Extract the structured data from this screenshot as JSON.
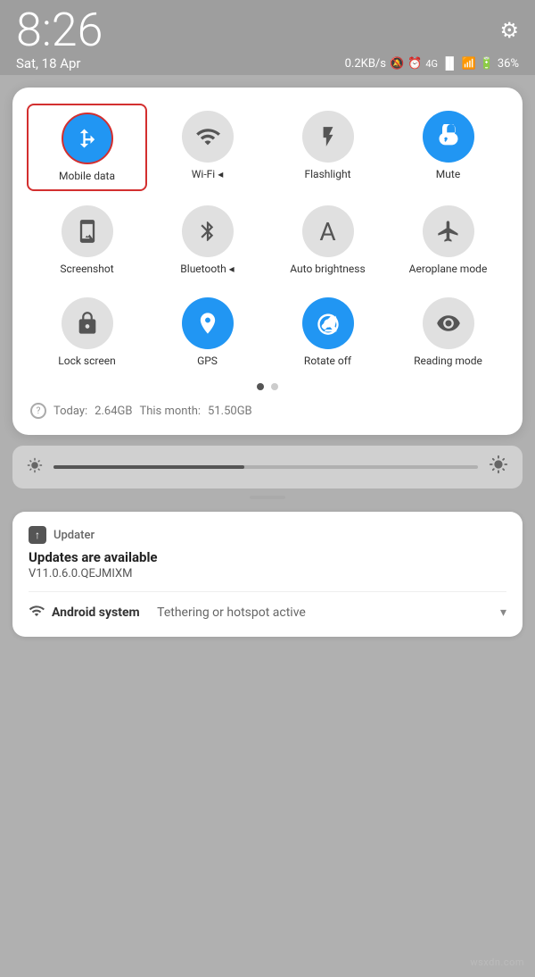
{
  "statusBar": {
    "time": "8:26",
    "date": "Sat, 18 Apr",
    "speed": "0.2KB/s",
    "battery": "36%"
  },
  "tiles": [
    {
      "id": "mobile-data",
      "label": "Mobile data",
      "state": "active",
      "selected": true
    },
    {
      "id": "wifi",
      "label": "Wi-Fi",
      "state": "inactive"
    },
    {
      "id": "flashlight",
      "label": "Flashlight",
      "state": "inactive"
    },
    {
      "id": "mute",
      "label": "Mute",
      "state": "active"
    },
    {
      "id": "screenshot",
      "label": "Screenshot",
      "state": "inactive"
    },
    {
      "id": "bluetooth",
      "label": "Bluetooth",
      "state": "inactive"
    },
    {
      "id": "auto-brightness",
      "label": "Auto brightness",
      "state": "inactive"
    },
    {
      "id": "aeroplane",
      "label": "Aeroplane mode",
      "state": "inactive"
    },
    {
      "id": "lock-screen",
      "label": "Lock screen",
      "state": "inactive"
    },
    {
      "id": "gps",
      "label": "GPS",
      "state": "active"
    },
    {
      "id": "rotate-off",
      "label": "Rotate off",
      "state": "active"
    },
    {
      "id": "reading-mode",
      "label": "Reading mode",
      "state": "inactive"
    }
  ],
  "dataUsage": {
    "today_label": "Today:",
    "today_value": "2.64GB",
    "month_label": "This month:",
    "month_value": "51.50GB"
  },
  "dots": [
    {
      "active": true
    },
    {
      "active": false
    }
  ],
  "notifications": [
    {
      "app_icon": "↑",
      "app_name": "Updater",
      "title": "Updates are available",
      "body": "V11.0.6.0.QEJMIXM"
    }
  ],
  "androidSystem": {
    "app_name": "Android system",
    "message": "Tethering or hotspot active"
  },
  "watermark": "wsxdn.com"
}
